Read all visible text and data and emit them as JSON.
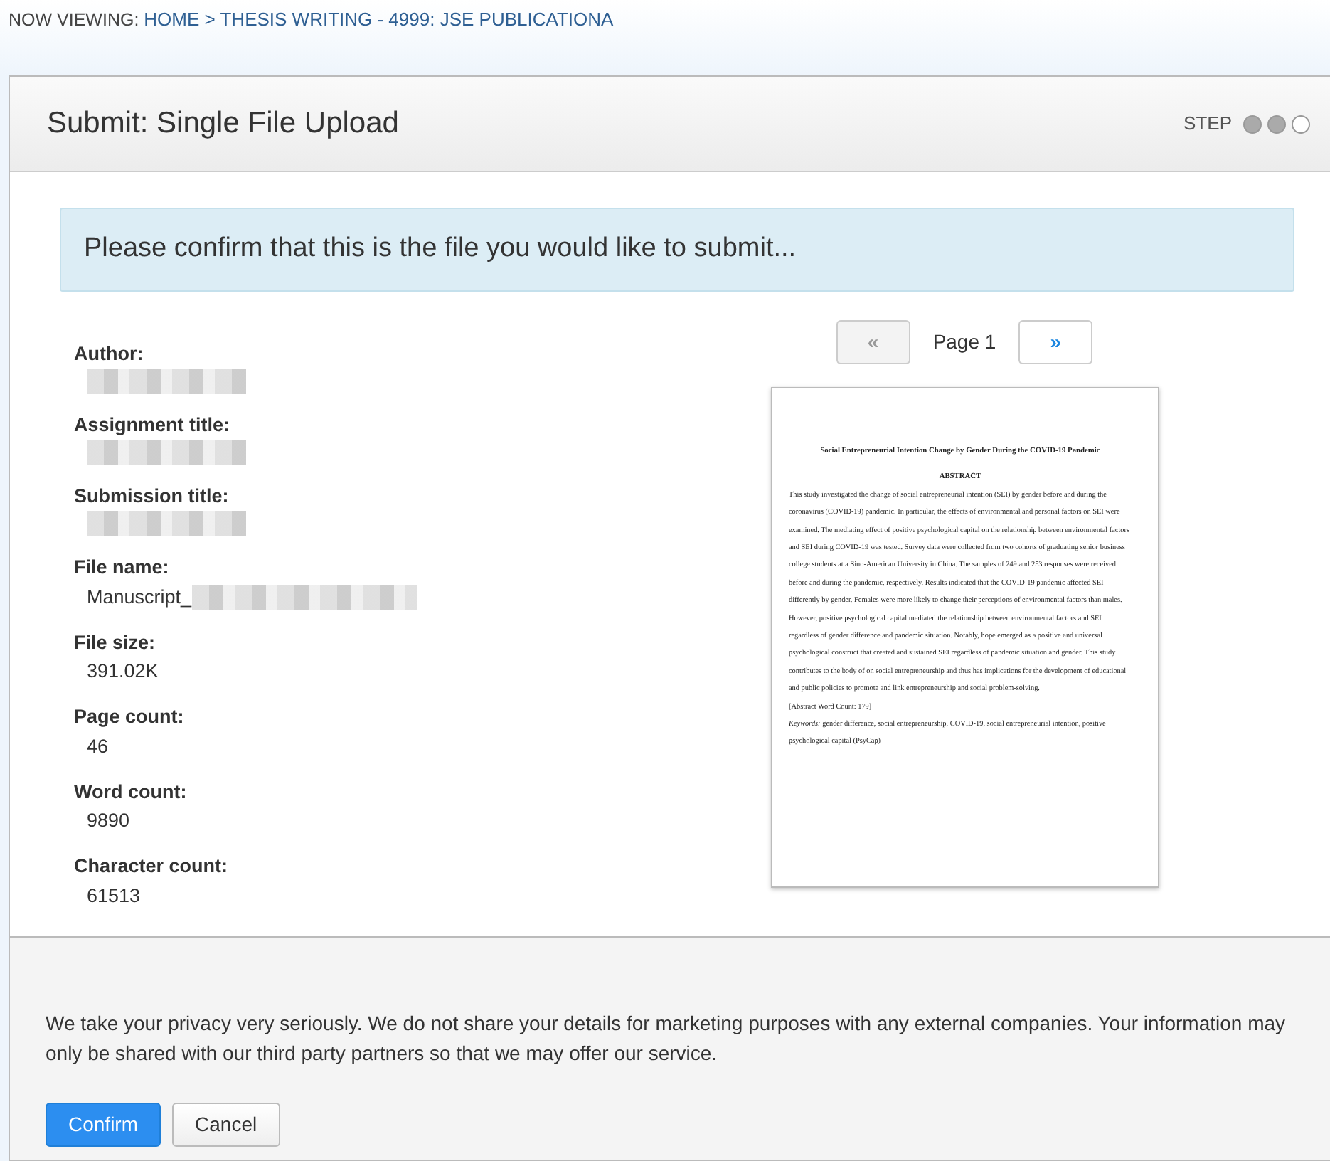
{
  "breadcrumb": {
    "label": "NOW VIEWING:",
    "path": "HOME > THESIS WRITING - 4999: JSE PUBLICATIONA"
  },
  "panel": {
    "title": "Submit: Single File Upload",
    "step_label": "STEP",
    "steps": [
      {
        "done": true
      },
      {
        "done": true
      },
      {
        "done": false
      }
    ]
  },
  "notice": "Please confirm that this is the file you would like to submit...",
  "details": [
    {
      "label": "Author:",
      "value_parts": [
        {
          "kind": "redacted"
        }
      ]
    },
    {
      "label": "Assignment title:",
      "value_parts": [
        {
          "kind": "redacted"
        }
      ]
    },
    {
      "label": "Submission title:",
      "value_parts": [
        {
          "kind": "redacted"
        }
      ]
    },
    {
      "label": "File name:",
      "value_parts": [
        {
          "kind": "text",
          "text": "Manuscript_"
        },
        {
          "kind": "redacted"
        }
      ]
    },
    {
      "label": "File size:",
      "value_parts": [
        {
          "kind": "text",
          "text": "391.02K"
        }
      ]
    },
    {
      "label": "Page count:",
      "value_parts": [
        {
          "kind": "text",
          "text": "46"
        }
      ]
    },
    {
      "label": "Word count:",
      "value_parts": [
        {
          "kind": "text",
          "text": "9890"
        }
      ]
    },
    {
      "label": "Character count:",
      "value_parts": [
        {
          "kind": "text",
          "text": "61513"
        }
      ]
    }
  ],
  "pager": {
    "prev": {
      "label": "«",
      "disabled": true
    },
    "page_label": "Page 1",
    "next": {
      "label": "»",
      "disabled": false
    }
  },
  "preview": {
    "title": "Social Entrepreneurial Intention Change by Gender During the COVID-19 Pandemic",
    "heading": "ABSTRACT",
    "paragraph": "This study investigated the change of social entrepreneurial intention (SEI) by gender before and during the coronavirus (COVID-19) pandemic. In particular, the effects of environmental and personal factors on SEI were examined. The mediating effect of positive psychological capital on the relationship between environmental factors and SEI during COVID-19 was tested. Survey data were collected from two cohorts of graduating senior business college students at a Sino-American University in China. The samples of 249 and 253 responses were received before and during the pandemic, respectively. Results indicated that the COVID-19 pandemic affected SEI differently by gender. Females were more likely to change their perceptions of environmental factors than males. However, positive psychological capital mediated the relationship between environmental factors and SEI regardless of gender difference and pandemic situation. Notably, hope emerged as a positive and universal psychological construct that created and sustained SEI regardless of pandemic situation and gender. This study contributes to the body of on social entrepreneurship and thus has implications for the development of educational and public policies to promote and link entrepreneurship and social problem-solving.",
    "word_count": "[Abstract Word Count: 179]",
    "keywords": "*Keywords:* gender difference, social entrepreneurship, COVID-19, social entrepreneurial intention, positive psychological capital (PsyCap)"
  },
  "privacy": "We take your privacy very seriously. We do not share your details for marketing purposes with any external companies. Your information may only be shared with our third party partners so that we may offer our service.",
  "buttons": [
    {
      "kind": "primary",
      "label": "Confirm"
    },
    {
      "kind": "secondary",
      "label": "Cancel"
    }
  ]
}
